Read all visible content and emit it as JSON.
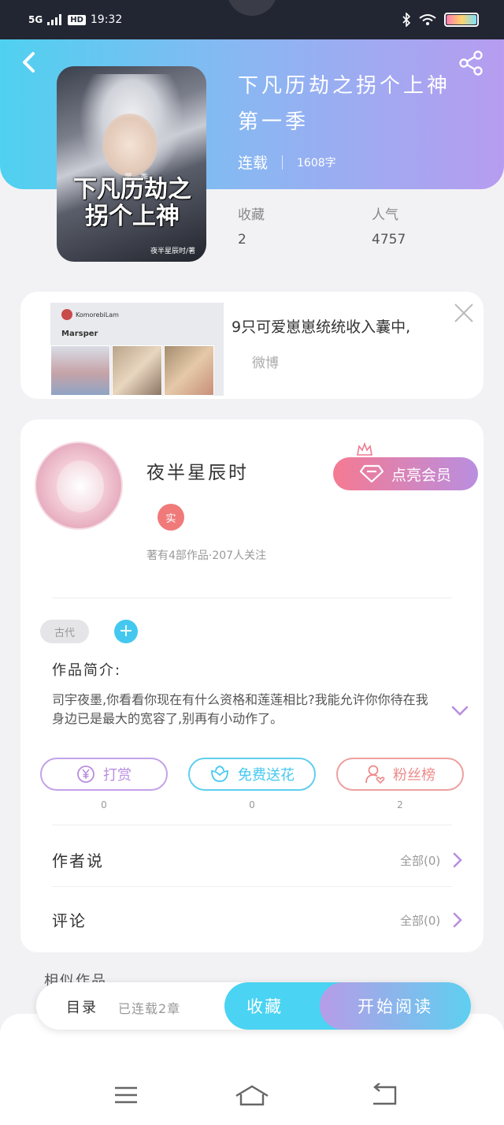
{
  "status_bar": {
    "network": "5G",
    "hd": "HD",
    "time": "19:32"
  },
  "book": {
    "title": "下凡历劫之拐个上神第一季",
    "status": "连载",
    "word_count": "1608字",
    "stats": [
      {
        "label": "收藏",
        "value": "2"
      },
      {
        "label": "人气",
        "value": "4757"
      }
    ],
    "cover": {
      "title": "下凡历劫之拐个上神",
      "season": "第一季",
      "author": "夜半星辰时/著"
    }
  },
  "ad": {
    "account": "KomorebiLam",
    "name": "Marsper",
    "text": "9只可爱崽崽统统收入囊中,",
    "source": "微博"
  },
  "author": {
    "name": "夜半星辰时",
    "badge": "实",
    "stats": "著有4部作品·207人关注",
    "vip_label": "点亮会员"
  },
  "tags": {
    "genre": "古代",
    "add": "+"
  },
  "intro": {
    "label": "作品简介:",
    "text": "司宇夜墨,你看看你现在有什么资格和莲莲相比?我能允许你你待在我身边已是最大的宽容了,别再有小动作了。"
  },
  "actions": [
    {
      "label": "打赏",
      "count": "0",
      "color": "#b98ee0"
    },
    {
      "label": "免费送花",
      "count": "0",
      "color": "#45c8f0"
    },
    {
      "label": "粉丝榜",
      "count": "2",
      "color": "#ee8a8a"
    }
  ],
  "rows": {
    "author_says": {
      "label": "作者说",
      "meta": "全部(0)"
    },
    "comments": {
      "label": "评论",
      "meta": "全部(0)"
    }
  },
  "similar_label": "相似作品",
  "bottom_bar": {
    "toc_label": "目录",
    "toc_status": "已连载2章",
    "favorite_label": "收藏",
    "read_label": "开始阅读"
  },
  "colors": {
    "header_start": "#4fd1f0",
    "header_end": "#b79cf0",
    "accent_blue": "#45c8f0",
    "accent_purple": "#b98ee0",
    "accent_pink": "#f57a92"
  },
  "icons": [
    "back-icon",
    "share-icon",
    "close-icon",
    "diamond-icon",
    "crown-icon",
    "chevron-down-icon",
    "yen-icon",
    "flower-icon",
    "fan-icon",
    "chevron-right-icon",
    "menu-icon",
    "home-icon",
    "return-icon"
  ]
}
